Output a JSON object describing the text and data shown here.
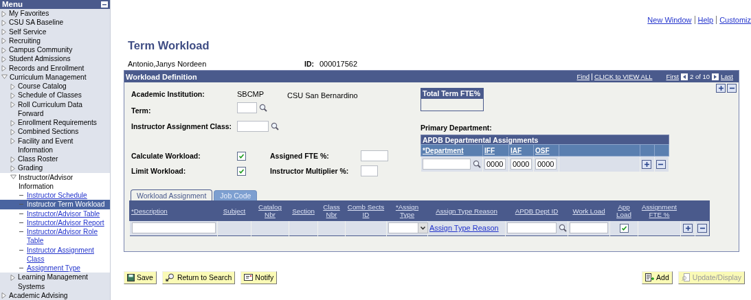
{
  "menu": {
    "title": "Menu",
    "items": [
      {
        "label": "My Favorites",
        "kind": "folder",
        "expanded": false
      },
      {
        "label": "CSU SA Baseline",
        "kind": "folder",
        "expanded": false
      },
      {
        "label": "Self Service",
        "kind": "folder",
        "expanded": false
      },
      {
        "label": "Recruiting",
        "kind": "folder",
        "expanded": false
      },
      {
        "label": "Campus Community",
        "kind": "folder",
        "expanded": false
      },
      {
        "label": "Student Admissions",
        "kind": "folder",
        "expanded": false
      },
      {
        "label": "Records and Enrollment",
        "kind": "folder",
        "expanded": false
      },
      {
        "label": "Curriculum Management",
        "kind": "folder",
        "expanded": true,
        "children": [
          {
            "label": "Course Catalog",
            "kind": "folder",
            "expanded": false
          },
          {
            "label": "Schedule of Classes",
            "kind": "folder",
            "expanded": false
          },
          {
            "label": "Roll Curriculum Data Forward",
            "kind": "folder",
            "expanded": false
          },
          {
            "label": "Enrollment Requirements",
            "kind": "folder",
            "expanded": false
          },
          {
            "label": "Combined Sections",
            "kind": "folder",
            "expanded": false
          },
          {
            "label": "Facility and Event Information",
            "kind": "folder",
            "expanded": false
          },
          {
            "label": "Class Roster",
            "kind": "folder",
            "expanded": false
          },
          {
            "label": "Grading",
            "kind": "folder",
            "expanded": false
          },
          {
            "label": "Instructor/Advisor Information",
            "kind": "folder",
            "expanded": true,
            "children": [
              {
                "label": "Instructor Schedule",
                "kind": "link",
                "selected": false
              },
              {
                "label": "Instructor Term Workload",
                "kind": "link",
                "selected": true
              },
              {
                "label": "Instructor/Advisor Table",
                "kind": "link",
                "selected": false
              },
              {
                "label": "Instructor/Advisor Report",
                "kind": "link",
                "selected": false
              },
              {
                "label": "Instructor/Advisor Role Table",
                "kind": "link",
                "selected": false
              },
              {
                "label": "Instructor Assignment Class",
                "kind": "link",
                "selected": false
              },
              {
                "label": "Assignment Type",
                "kind": "link",
                "selected": false
              }
            ]
          },
          {
            "label": "Learning Management Systems",
            "kind": "folder",
            "expanded": false
          }
        ]
      },
      {
        "label": "Academic Advising",
        "kind": "folder",
        "expanded": false
      }
    ]
  },
  "top_links": [
    "New Window",
    "Help",
    "Customiz"
  ],
  "page_title": "Term Workload",
  "person": {
    "name": "Antonio,Janys Nordeen",
    "id_label": "ID:",
    "id": "000017562"
  },
  "panel": {
    "title": "Workload Definition",
    "nav": {
      "find": "Find",
      "view_all": "CLICK to VIEW ALL",
      "first": "First",
      "position": "2 of 10",
      "last": "Last"
    },
    "institution": {
      "label": "Academic Institution:",
      "code": "SBCMP",
      "name": "CSU San Bernardino"
    },
    "term": {
      "label": "Term:"
    },
    "assignment_class": {
      "label": "Instructor Assignment Class:"
    },
    "options": [
      {
        "label": "Calculate Workload:",
        "checked": true,
        "field_label": "Assigned FTE %:"
      },
      {
        "label": "Limit Workload:",
        "checked": true,
        "field_label": "Instructor Multiplier %:"
      }
    ],
    "total_fte": {
      "title": "Total Term FTE%"
    },
    "primary_department": {
      "label": "Primary Department:"
    },
    "apdb": {
      "title": "APDB Departmental Assignments",
      "columns": [
        "*Department",
        "IFF",
        "IAF",
        "OSF"
      ],
      "values": [
        "0000",
        "0000",
        "0000"
      ]
    },
    "tabs": [
      {
        "label": "Workload Assignment",
        "selected": true
      },
      {
        "label": "Job Code",
        "selected": false
      }
    ],
    "grid": {
      "columns": [
        "*Description",
        "Subject",
        "Catalog Nbr",
        "Section",
        "Class Nbr",
        "Comb Sects ID",
        "*Assign Type",
        "Assign Type Reason",
        "APDB Dept ID",
        "Work Load",
        "App Load",
        "Assignment FTE %"
      ],
      "row": {
        "assign_type_reason": "Assign Type Reason",
        "app_load_checked": true
      }
    }
  },
  "left_buttons": [
    {
      "label": "Save",
      "kind": "save",
      "disabled": false
    },
    {
      "label": "Return to Search",
      "kind": "search",
      "disabled": false
    },
    {
      "label": "Notify",
      "kind": "notify",
      "disabled": false
    }
  ],
  "right_buttons": [
    {
      "label": "Add",
      "kind": "add",
      "disabled": false
    },
    {
      "label": "Update/Display",
      "kind": "update",
      "disabled": true
    }
  ]
}
